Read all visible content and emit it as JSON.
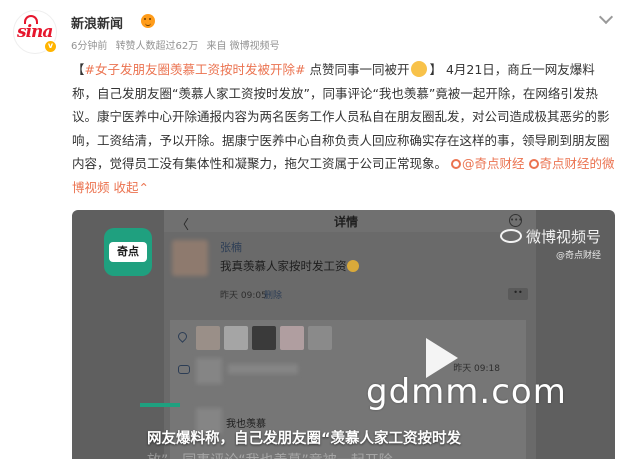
{
  "author": {
    "name": "新浪新闻",
    "logo_text": "sina",
    "meta": [
      "6分钟前",
      "转赞人数超过62万",
      "来自 微博视频号"
    ]
  },
  "post": {
    "bracket_open": "【",
    "hashtag": "#女子发朋友圈羡慕工资按时发被开除#",
    "title_rest": " 点赞同事一同被开",
    "bracket_close": "】",
    "body": "4月21日，商丘一网友爆料称，自己发朋友圈“羡慕人家工资按时发放”，同事评论“我也羡慕”竟被一起开除，在网络引发热议。康宁医养中心开除通报内容为两名医务工作人员私自在朋友圈乱发，对公司造成极其恶劣的影响，工资结清，予以开除。据康宁医养中心自称负责人回应称确实存在这样的事，领导刷到朋友圈内容，觉得员工没有集体性和凝聚力，拖欠工资属于公司正常现象。",
    "mention": "@奇点财经",
    "video_link": "奇点财经的微博视频",
    "collect": "收起",
    "collect_arrow": "⌃"
  },
  "video": {
    "phone_title": "详情",
    "back_glyph": "〈",
    "more_glyph": "•••",
    "opts_glyph": "••",
    "comment_name": "张楠",
    "comment_text": "我真羡慕人家按时发工资",
    "comment_time": "昨天 09:05",
    "comment_delete": "删除",
    "reply_time": "昨天 09:18",
    "reply_text": "我也羡慕",
    "channel_logo": "奇点",
    "watermark_brand": "微博视频号",
    "watermark_sub": "@奇点财经",
    "watermark_site": "gdmm.com",
    "caption": "网友爆料称，自己发朋友圈“羡慕人家工资按时发",
    "caption_faded": "放”，同事评论“我也羡慕”竟被一起开除"
  }
}
